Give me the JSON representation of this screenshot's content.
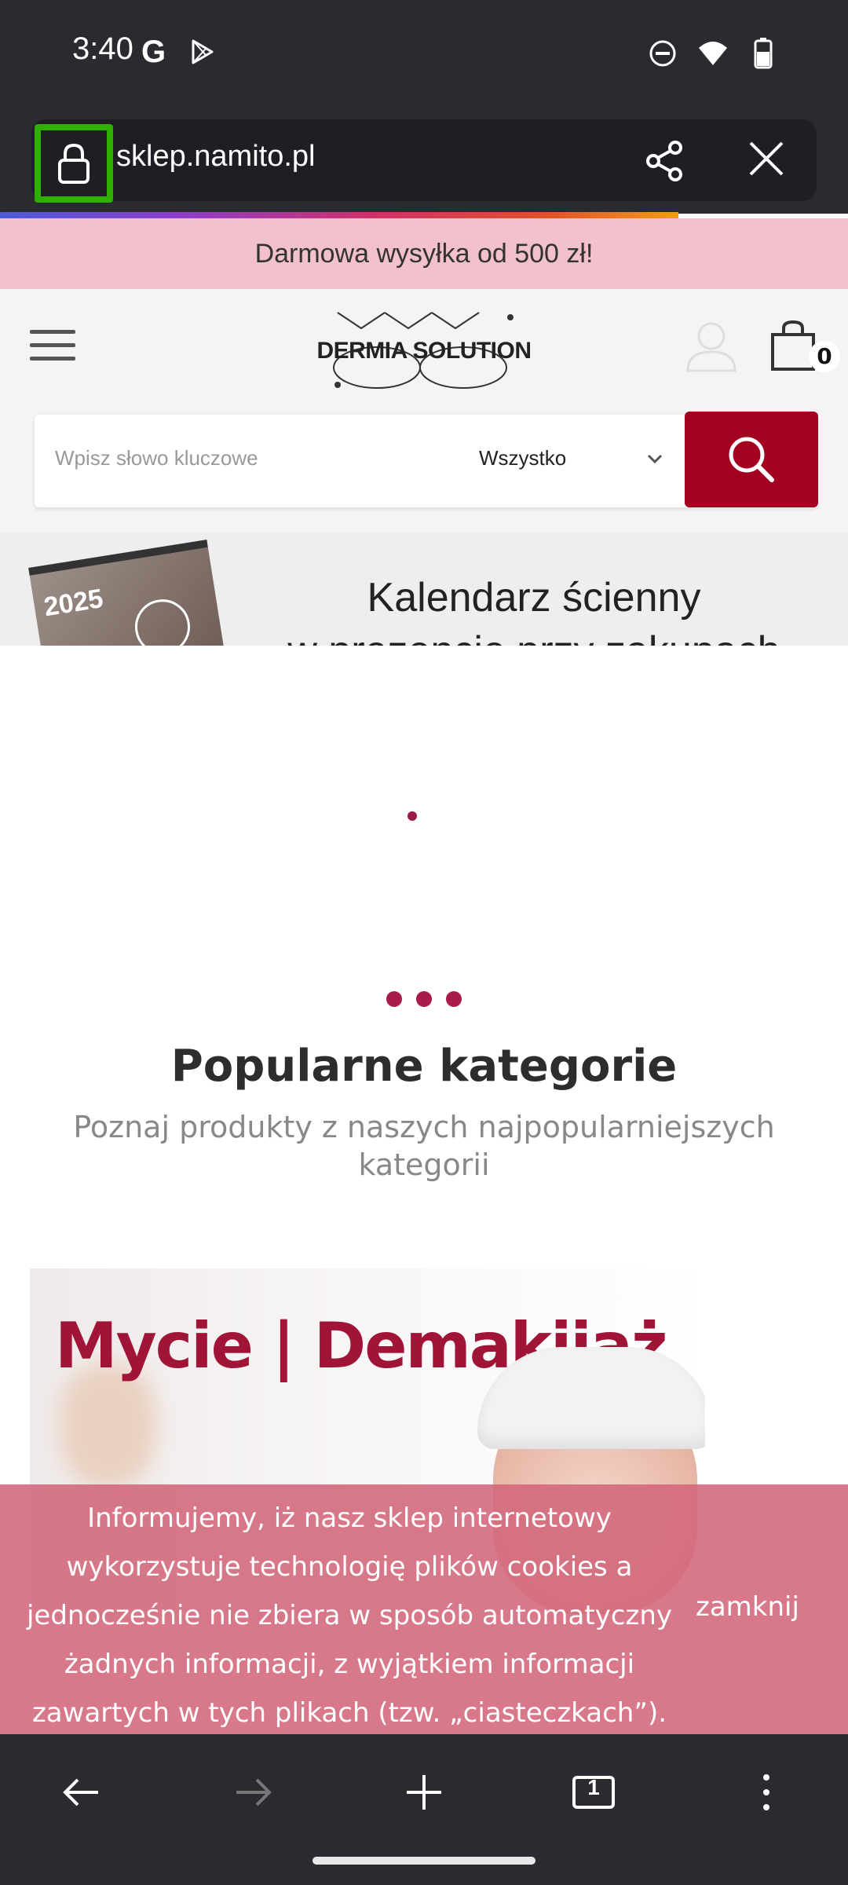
{
  "status_bar": {
    "time": "3:40",
    "google_icon": "G"
  },
  "browser": {
    "url": "sklep.namito.pl",
    "lock_icon": "lock-icon",
    "share_icon": "share-icon",
    "close_icon": "close-icon",
    "progress_percent": 80
  },
  "promo": {
    "text": "Darmowa wysyłka od 500 zł!"
  },
  "header": {
    "logo_text": "DERMIA SOLUTION",
    "cart_count": "0"
  },
  "search": {
    "placeholder": "Wpisz słowo kluczowe",
    "category": "Wszystko"
  },
  "banner": {
    "year": "2025",
    "title_line1": "Kalendarz ścienny",
    "title_line2": "w prezencie przy zakupach"
  },
  "categories": {
    "title": "Popularne kategorie",
    "subtitle": "Poznaj produkty z naszych najpopularniejszych kategorii",
    "card_title": "Mycie | Demakijaż"
  },
  "cookie": {
    "text": "Informujemy, iż nasz sklep internetowy wykorzystuje technologię plików cookies a jednocześnie nie zbiera w sposób automatyczny żadnych informacji, z wyjątkiem informacji zawartych w tych plikach (tzw. „ciasteczkach”).",
    "close_label": "zamknij"
  },
  "bottom_nav": {
    "tab_count": "1"
  },
  "colors": {
    "brand_red": "#a30022",
    "promo_pink": "#f3c1cb",
    "cookie_pink": "#d1667a",
    "lock_highlight": "#2fb000"
  }
}
